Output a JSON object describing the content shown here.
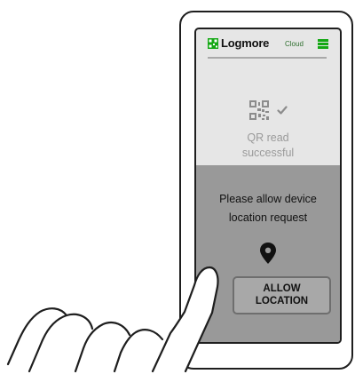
{
  "app": {
    "brand": "Logmore",
    "brand_sub": "Cloud"
  },
  "qr": {
    "status_line1": "QR read",
    "status_line2": "successful"
  },
  "location_prompt": {
    "message_line1": "Please allow device",
    "message_line2": "location request",
    "button_line1": "ALLOW",
    "button_line2": "LOCATION"
  },
  "icons": {
    "logo": "qr-logo-icon",
    "menu": "hamburger-menu-icon",
    "qr": "qr-code-icon",
    "check": "checkmark-icon",
    "location": "map-pin-icon"
  },
  "colors": {
    "brand_accent": "#14a814",
    "screen_bg": "#e6e6e6",
    "overlay_bg": "#999999",
    "button_bg": "#a8a8a8",
    "outline": "#1e1e1e"
  }
}
